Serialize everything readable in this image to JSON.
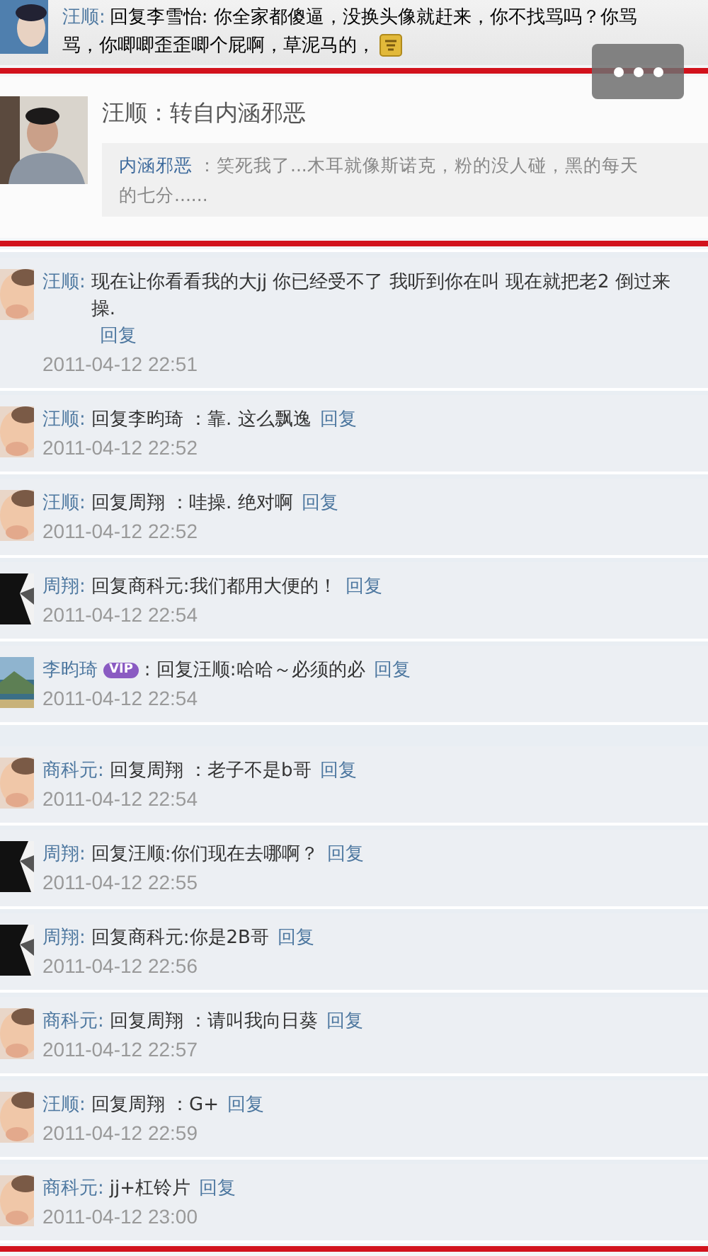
{
  "top_comment": {
    "author": "汪顺:",
    "lines": [
      "回复李雪怡: 你全家都傻逼，没换头像就赶来，你不找骂吗？你骂",
      "骂，你唧唧歪歪唧个屁啊，草泥马的，"
    ]
  },
  "repost": {
    "title": "汪顺：转自内涵邪恶",
    "quote_author": "内涵邪恶",
    "quote_lines": [
      "：笑死我了...木耳就像斯诺克，粉的没人碰，黑的每天",
      "的七分......"
    ]
  },
  "comments": [
    {
      "kind": "baby",
      "author": "汪顺:",
      "text": "现在让你看看我的大jj 你已经受不了 我听到你在叫 现在就把老2 倒过来操.",
      "reply": "回复",
      "time": "2011-04-12 22:51"
    },
    {
      "kind": "baby",
      "author": "汪顺:",
      "text": "回复李昀琦 ：靠. 这么飘逸",
      "reply": "回复",
      "time": "2011-04-12 22:52"
    },
    {
      "kind": "baby",
      "author": "汪顺:",
      "text": "回复周翔 ：哇操. 绝对啊",
      "reply": "回复",
      "time": "2011-04-12 22:52"
    },
    {
      "kind": "dark",
      "author": "周翔:",
      "text": "回复商科元:我们都用大便的！",
      "reply": "回复",
      "time": "2011-04-12 22:54"
    },
    {
      "kind": "scenery",
      "author": "李昀琦",
      "badge": "VIP",
      "text": ": 回复汪顺:哈哈～必须的必",
      "reply": "回复",
      "time": "2011-04-12 22:54"
    },
    {
      "kind": "baby",
      "author": "商科元:",
      "text": "回复周翔 ：老子不是b哥",
      "reply": "回复",
      "time": "2011-04-12 22:54"
    },
    {
      "kind": "dark",
      "author": "周翔:",
      "text": "回复汪顺:你们现在去哪啊？",
      "reply": "回复",
      "time": "2011-04-12 22:55"
    },
    {
      "kind": "dark",
      "author": "周翔:",
      "text": "回复商科元:你是2B哥",
      "reply": "回复",
      "time": "2011-04-12 22:56"
    },
    {
      "kind": "baby",
      "author": "商科元:",
      "text": "回复周翔 ：请叫我向日葵",
      "reply": "回复",
      "time": "2011-04-12 22:57"
    },
    {
      "kind": "baby",
      "author": "汪顺:",
      "text": "回复周翔 ：G+",
      "reply": "回复",
      "time": "2011-04-12 22:59"
    },
    {
      "kind": "baby",
      "author": "商科元:",
      "text": "jj+杠铃片",
      "reply": "回复",
      "time": "2011-04-12 23:00"
    }
  ]
}
